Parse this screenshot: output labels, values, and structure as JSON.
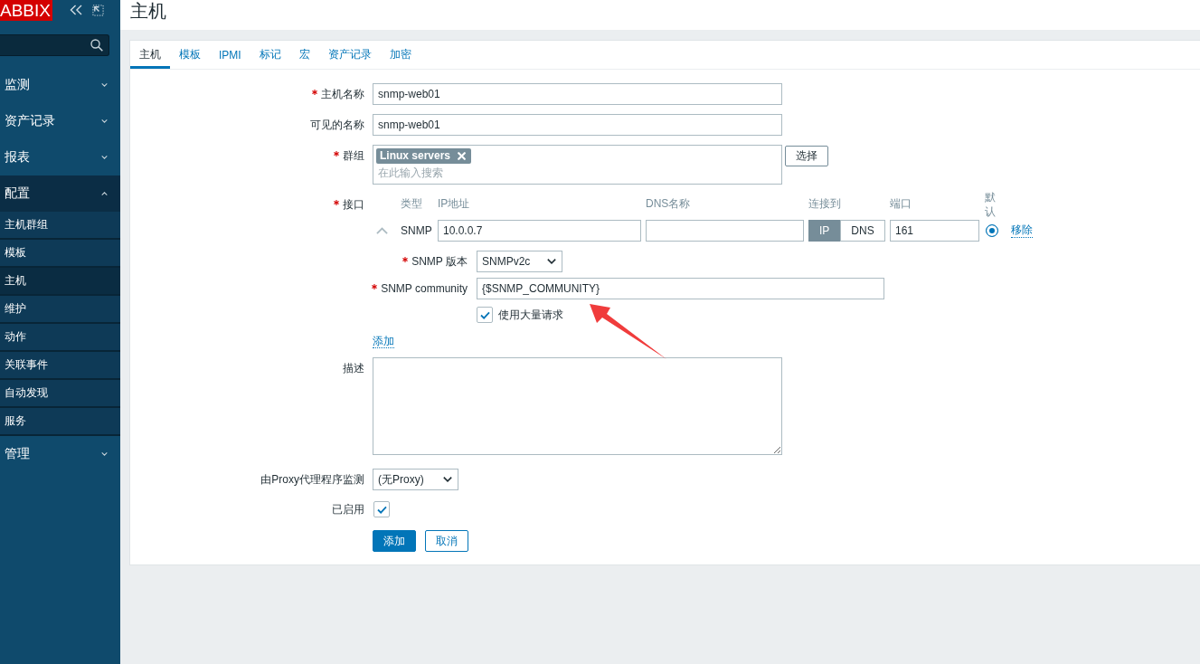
{
  "sidebar": {
    "logo": "ABBIX",
    "menu": [
      {
        "label": "监测",
        "expanded": false
      },
      {
        "label": "资产记录",
        "expanded": false
      },
      {
        "label": "报表",
        "expanded": false
      },
      {
        "label": "配置",
        "expanded": true,
        "children": [
          {
            "label": "主机群组",
            "selected": false
          },
          {
            "label": "模板",
            "selected": false
          },
          {
            "label": "主机",
            "selected": true
          },
          {
            "label": "维护",
            "selected": false
          },
          {
            "label": "动作",
            "selected": false
          },
          {
            "label": "关联事件",
            "selected": false
          },
          {
            "label": "自动发现",
            "selected": false
          },
          {
            "label": "服务",
            "selected": false
          }
        ]
      },
      {
        "label": "管理",
        "expanded": false
      }
    ]
  },
  "page": {
    "title": "主机"
  },
  "tabs": [
    {
      "label": "主机",
      "selected": true
    },
    {
      "label": "模板",
      "selected": false
    },
    {
      "label": "IPMI",
      "selected": false
    },
    {
      "label": "标记",
      "selected": false
    },
    {
      "label": "宏",
      "selected": false
    },
    {
      "label": "资产记录",
      "selected": false
    },
    {
      "label": "加密",
      "selected": false
    }
  ],
  "form": {
    "host_name": {
      "label": "主机名称",
      "required": true,
      "value": "snmp-web01"
    },
    "visible_name": {
      "label": "可见的名称",
      "required": false,
      "value": "snmp-web01"
    },
    "groups": {
      "label": "群组",
      "required": true,
      "tags": [
        "Linux servers"
      ],
      "placeholder": "在此输入搜索",
      "button": "选择"
    },
    "interfaces": {
      "label": "接口",
      "required": true,
      "columns": [
        "类型",
        "IP地址",
        "DNS名称",
        "连接到",
        "端口",
        "默认"
      ],
      "rows": [
        {
          "type": "SNMP",
          "expanded": true,
          "ip": "10.0.0.7",
          "connect": [
            {
              "label": "IP",
              "selected": true
            },
            {
              "label": "DNS",
              "selected": false
            }
          ],
          "port": "161",
          "default": true,
          "remove": "移除",
          "snmp_version": {
            "label": "SNMP 版本",
            "required": true,
            "value": "SNMPv2c"
          },
          "community": {
            "label": "SNMP community",
            "required": true,
            "value": "{$SNMP_COMMUNITY}"
          },
          "bulk": {
            "label": "使用大量请求",
            "checked": true
          }
        }
      ],
      "add": "添加"
    },
    "description": {
      "label": "描述"
    },
    "proxy": {
      "label": "由Proxy代理程序监测",
      "value": "(无Proxy)"
    },
    "enabled": {
      "label": "已启用",
      "checked": true
    },
    "buttons": [
      {
        "label": "添加",
        "kind": "primary"
      },
      {
        "label": "取消",
        "kind": "secondary"
      }
    ]
  }
}
